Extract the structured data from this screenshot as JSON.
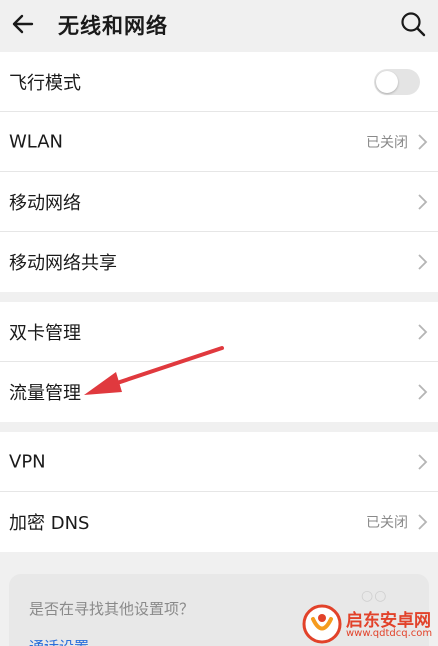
{
  "header": {
    "title": "无线和网络",
    "back_icon": "back-arrow-icon",
    "search_icon": "search-icon"
  },
  "group1": {
    "airplane": {
      "label": "飞行模式",
      "toggle_on": false
    },
    "wlan": {
      "label": "WLAN",
      "value": "已关闭"
    },
    "mobile_network": {
      "label": "移动网络"
    },
    "tethering": {
      "label": "移动网络共享"
    }
  },
  "group2": {
    "dual_sim": {
      "label": "双卡管理"
    },
    "data_usage": {
      "label": "流量管理"
    }
  },
  "group3": {
    "vpn": {
      "label": "VPN"
    },
    "private_dns": {
      "label": "加密 DNS",
      "value": "已关闭"
    }
  },
  "suggestion": {
    "question": "是否在寻找其他设置项？",
    "link": "通话设置"
  },
  "watermark": {
    "name": "启东安卓网",
    "url": "www.qdtdcq.com"
  },
  "colors": {
    "accent": "#2a6fdb",
    "annotation_arrow": "#e0393e",
    "background": "#f0f0f0"
  }
}
